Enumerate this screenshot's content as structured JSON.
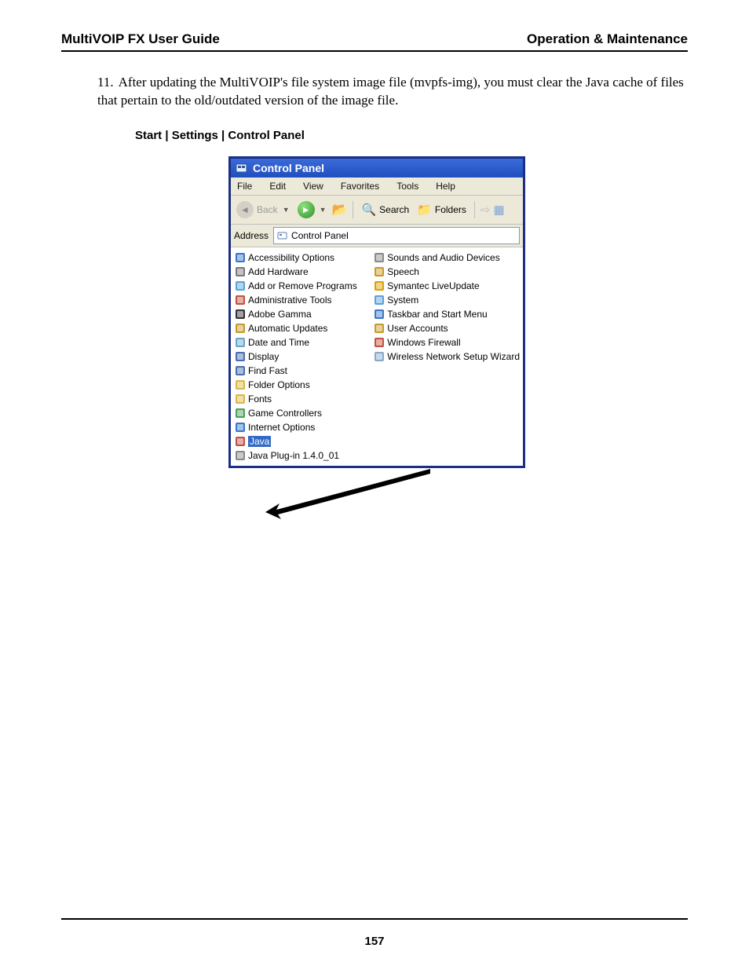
{
  "header": {
    "left": "MultiVOIP FX User Guide",
    "right": "Operation & Maintenance"
  },
  "step": {
    "num": "11.",
    "text": "After updating the MultiVOIP's file system image file (mvpfs-img), you must clear the Java cache of files that pertain to the old/outdated version of the image file."
  },
  "caption": "Start | Settings | Control Panel",
  "page_num": "157",
  "win": {
    "title": "Control Panel",
    "menus": [
      "File",
      "Edit",
      "View",
      "Favorites",
      "Tools",
      "Help"
    ],
    "tb": {
      "back": "Back",
      "search": "Search",
      "folders": "Folders"
    },
    "addr_label": "Address",
    "addr_value": "Control Panel",
    "left": [
      {
        "n": "Accessibility Options",
        "c": "#3a78c9"
      },
      {
        "n": "Add Hardware",
        "c": "#7a7a7a"
      },
      {
        "n": "Add or Remove Programs",
        "c": "#5aa3d8"
      },
      {
        "n": "Administrative Tools",
        "c": "#c1523f"
      },
      {
        "n": "Adobe Gamma",
        "c": "#333333"
      },
      {
        "n": "Automatic Updates",
        "c": "#c79a2b"
      },
      {
        "n": "Date and Time",
        "c": "#6aa6c8"
      },
      {
        "n": "Display",
        "c": "#4a6fae"
      },
      {
        "n": "Find Fast",
        "c": "#4a6fae"
      },
      {
        "n": "Folder Options",
        "c": "#d9b84a"
      },
      {
        "n": "Fonts",
        "c": "#d9b84a"
      },
      {
        "n": "Game Controllers",
        "c": "#4aa05a"
      },
      {
        "n": "Internet Options",
        "c": "#3a78c9"
      },
      {
        "n": "Java",
        "c": "#c1523f",
        "sel": true
      },
      {
        "n": "Java Plug-in 1.4.0_01",
        "c": "#8a8a8a"
      }
    ],
    "right": [
      {
        "n": "Sounds and Audio Devices",
        "c": "#8a8a8a"
      },
      {
        "n": "Speech",
        "c": "#c79a2b"
      },
      {
        "n": "Symantec LiveUpdate",
        "c": "#d9a300"
      },
      {
        "n": "System",
        "c": "#5aa3d8"
      },
      {
        "n": "Taskbar and Start Menu",
        "c": "#3a78c9"
      },
      {
        "n": "User Accounts",
        "c": "#c79a2b"
      },
      {
        "n": "Windows Firewall",
        "c": "#c1523f"
      },
      {
        "n": "Wireless Network Setup Wizard",
        "c": "#8aa8c8"
      }
    ]
  }
}
